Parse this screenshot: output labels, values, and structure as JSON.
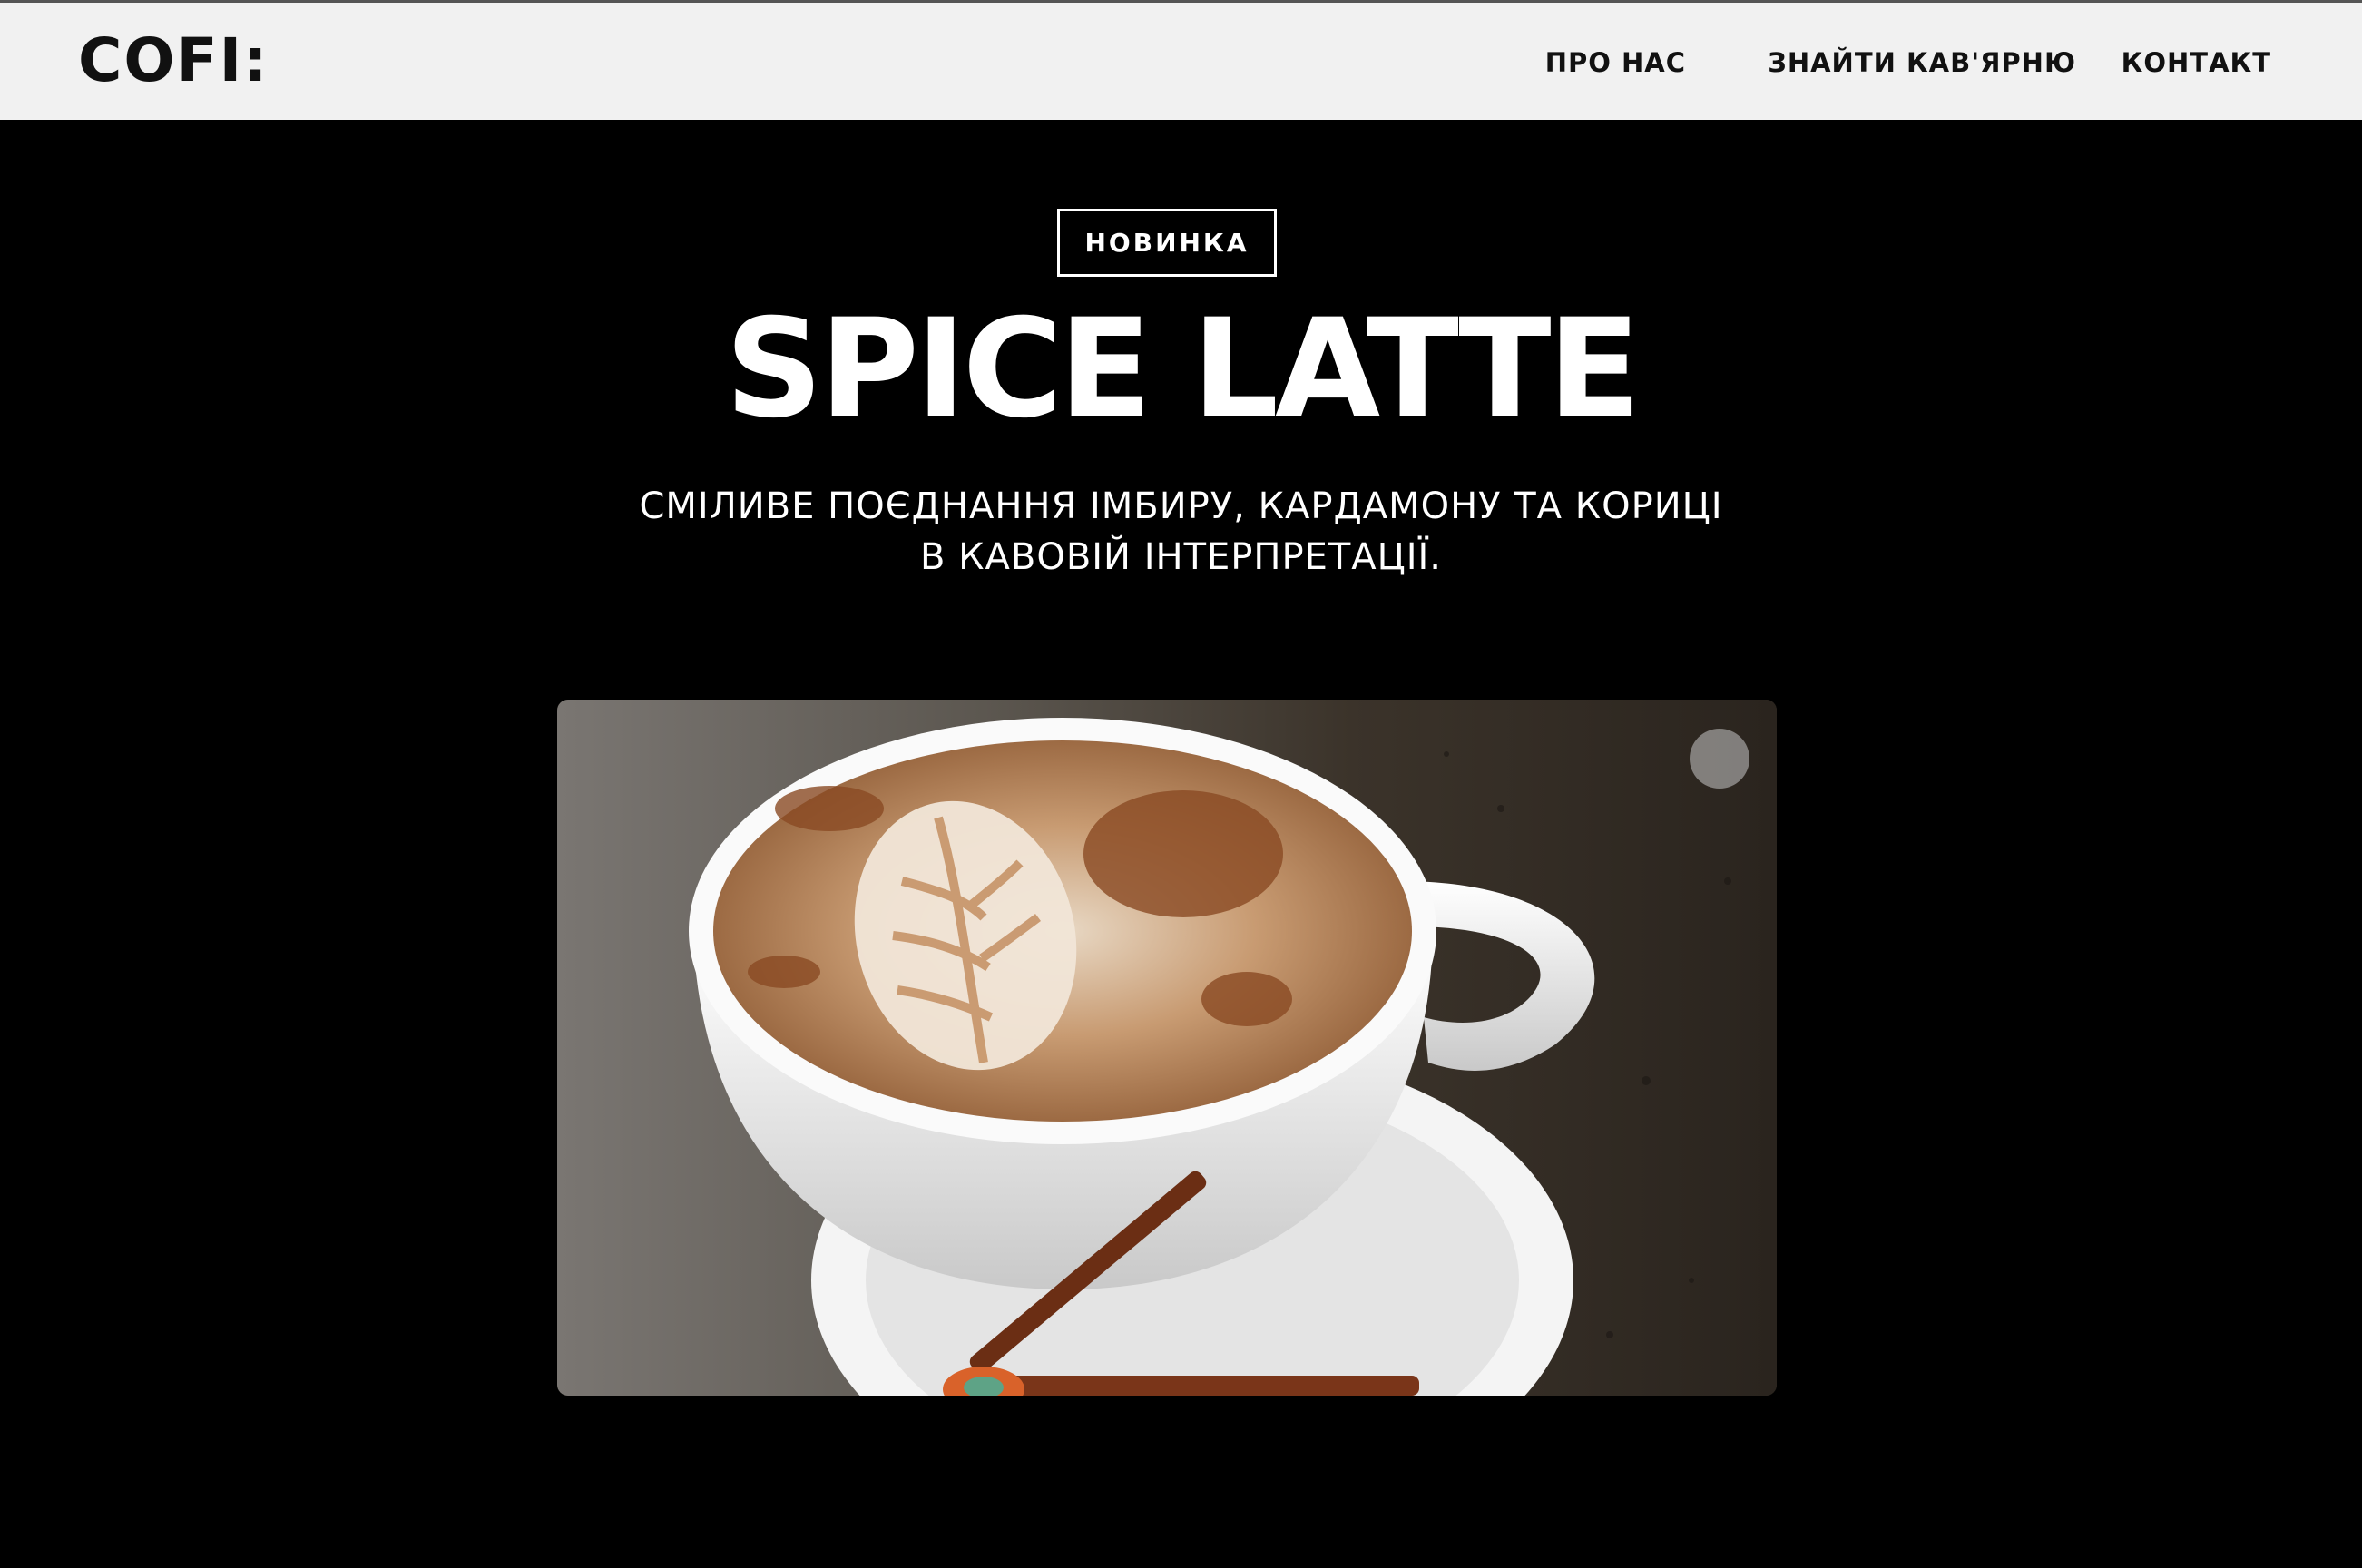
{
  "header": {
    "logo": "COFI:",
    "nav": [
      {
        "label": "ПРО НАС"
      },
      {
        "label": "ЗНАЙТИ КАВ'ЯРНЮ"
      },
      {
        "label": "КОНТАКТ"
      }
    ]
  },
  "hero": {
    "badge": "НОВИНКА",
    "title": "SPICE LATTE",
    "subtitle_line1": "СМІЛИВЕ ПОЄДНАННЯ ІМБИРУ, КАРДАМОНУ ТА КОРИЦІ",
    "subtitle_line2": "В КАВОВІЙ ІНТЕРПРЕТАЦІЇ."
  },
  "colors": {
    "header_bg": "#f1f1f1",
    "page_bg": "#000000",
    "text_light": "#ffffff",
    "text_dark": "#111111"
  },
  "icons": {
    "photo_indicator": "carousel-dot-icon"
  }
}
